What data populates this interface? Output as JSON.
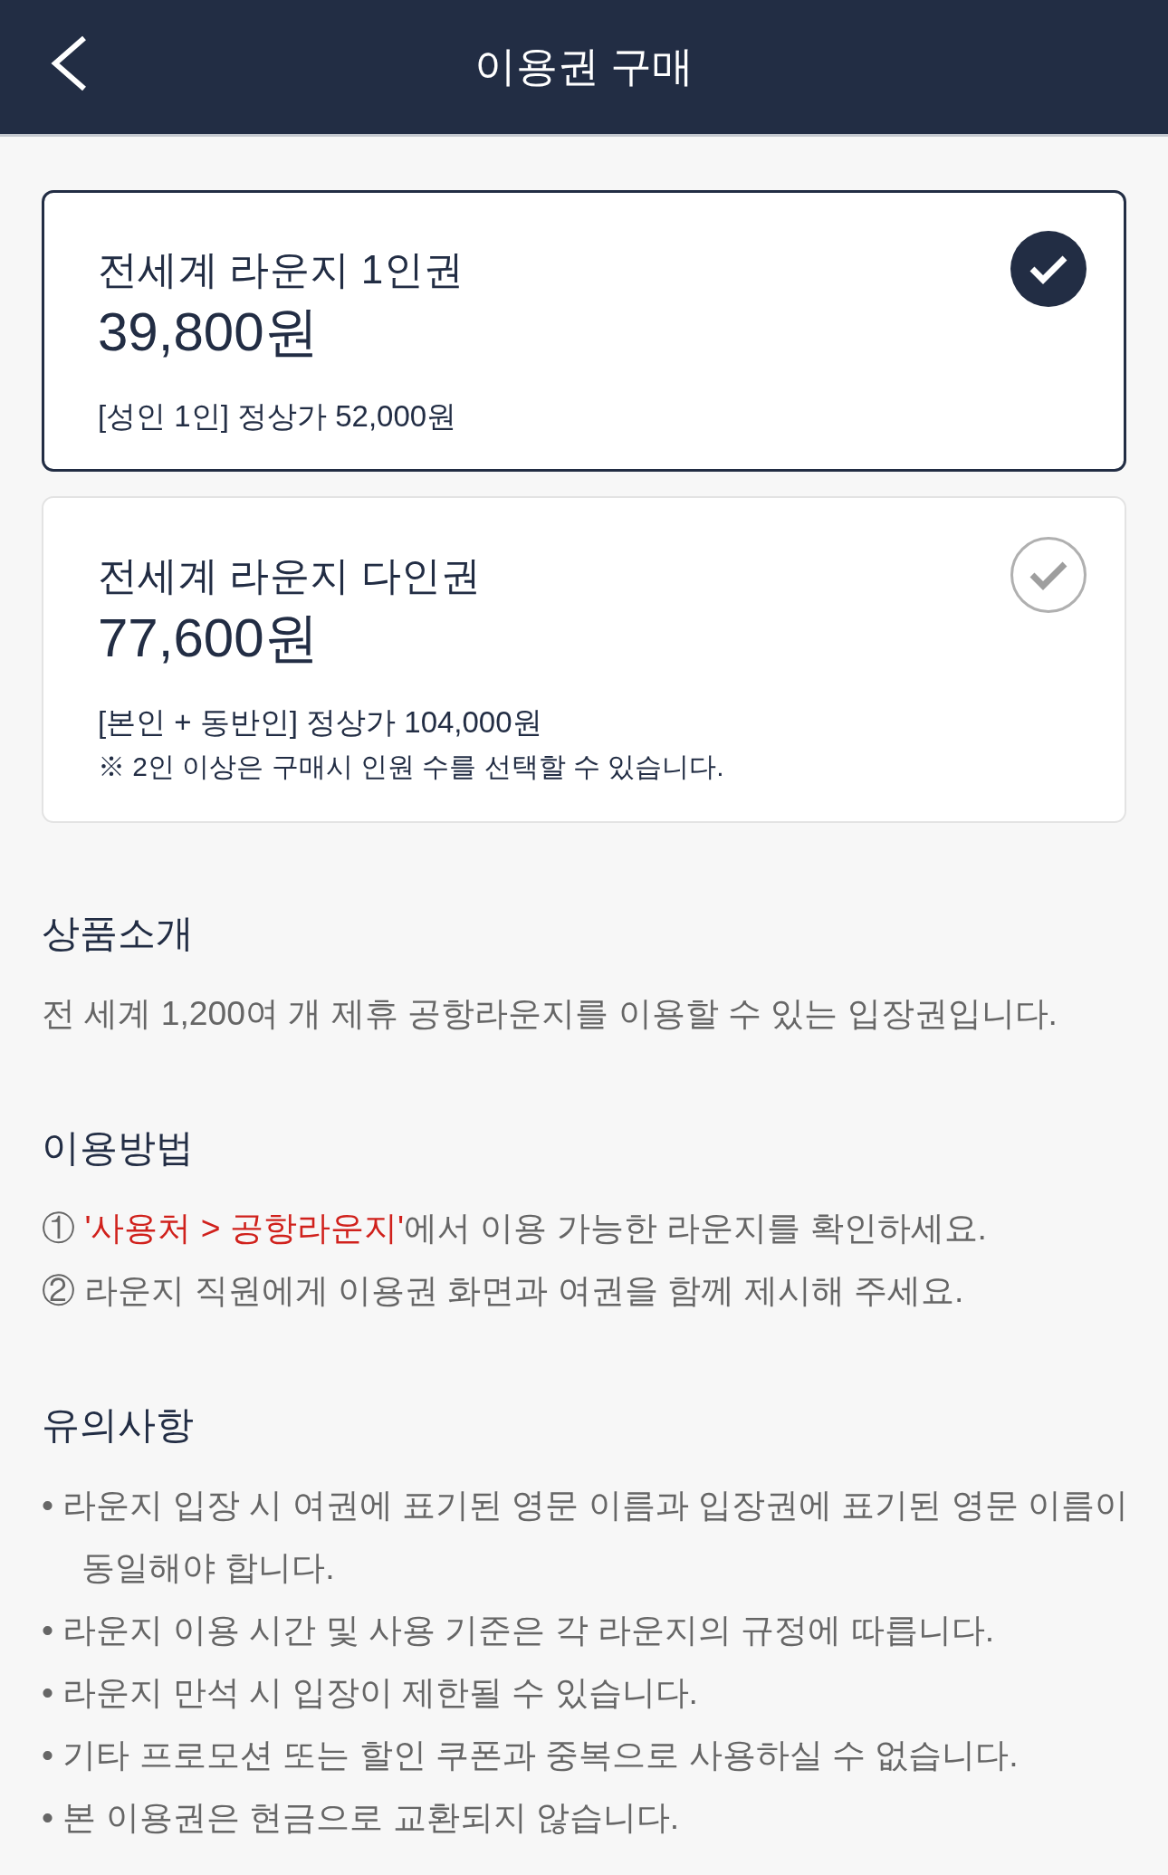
{
  "header": {
    "title": "이용권 구매"
  },
  "tickets": [
    {
      "name": "전세계 라운지 1인권",
      "price": "39,800원",
      "details": [
        {
          "kind": "price",
          "text": "[성인 1인] 정상가 52,000원"
        }
      ],
      "selected": true
    },
    {
      "name": "전세계 라운지 다인권",
      "price": "77,600원",
      "details": [
        {
          "kind": "price",
          "text": "[본인 + 동반인] 정상가 104,000원"
        },
        {
          "kind": "remark",
          "text": "※ 2인 이상은 구매시 인원 수를 선택할 수 있습니다."
        }
      ],
      "selected": false
    }
  ],
  "introduction": {
    "heading": "상품소개",
    "text": "전 세계 1,200여 개 제휴 공항라운지를 이용할 수 있는 입장권입니다."
  },
  "usage": {
    "heading": "이용방법",
    "steps": [
      {
        "number": "①",
        "link": "'사용처 > 공항라운지'",
        "text": "에서 이용 가능한 라운지를 확인하세요."
      },
      {
        "number": "②",
        "text": "라운지 직원에게 이용권 화면과 여권을 함께 제시해 주세요."
      }
    ]
  },
  "notes": {
    "heading": "유의사항",
    "items": [
      "• 라운지 입장 시 여권에 표기된 영문 이름과 입장권에 표기된 영문 이름이 동일해야 합니다.",
      "• 라운지 이용 시간 및 사용 기준은 각 라운지의 규정에 따릅니다.",
      "• 라운지 만석 시 입장이 제한될 수 있습니다.",
      "• 기타 프로모션 또는 할인 쿠폰과 중복으로 사용하실 수 없습니다.",
      "• 본 이용권은 현금으로 교환되지 않습니다."
    ]
  }
}
